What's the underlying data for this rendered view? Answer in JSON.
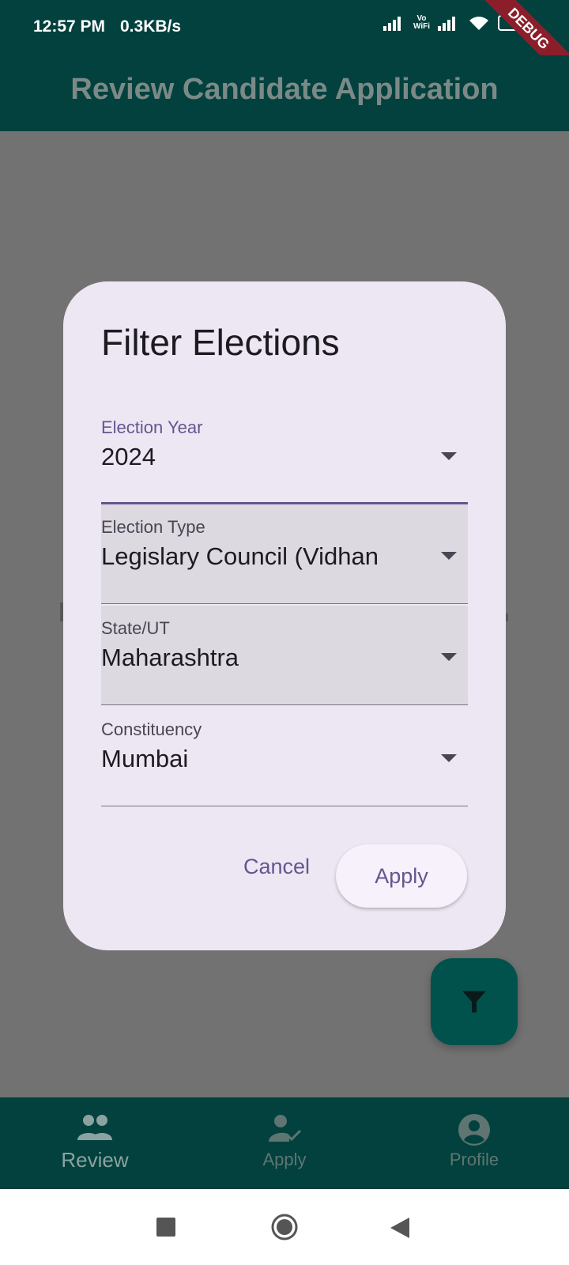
{
  "status_bar": {
    "time": "12:57 PM",
    "speed": "0.3KB/s",
    "volte_line1": "Vo",
    "volte_line2": "WiFi",
    "debug_label": "DEBUG"
  },
  "app_bar": {
    "title": "Review Candidate Application"
  },
  "dialog": {
    "title": "Filter Elections",
    "fields": [
      {
        "label": "Election Year",
        "value": "2024"
      },
      {
        "label": "Election Type",
        "value": "Legislary Council (Vidhan"
      },
      {
        "label": "State/UT",
        "value": "Maharashtra"
      },
      {
        "label": "Constituency",
        "value": "Mumbai"
      }
    ],
    "cancel_label": "Cancel",
    "apply_label": "Apply"
  },
  "bottom_nav": {
    "items": [
      {
        "label": "Review",
        "icon": "people-icon"
      },
      {
        "label": "Apply",
        "icon": "person-check-icon"
      },
      {
        "label": "Profile",
        "icon": "account-circle-icon"
      }
    ]
  },
  "colors": {
    "app_bar": "#02413e",
    "accent": "#65558f",
    "dialog_surface": "#ede7f4",
    "scrim": "#727272"
  }
}
